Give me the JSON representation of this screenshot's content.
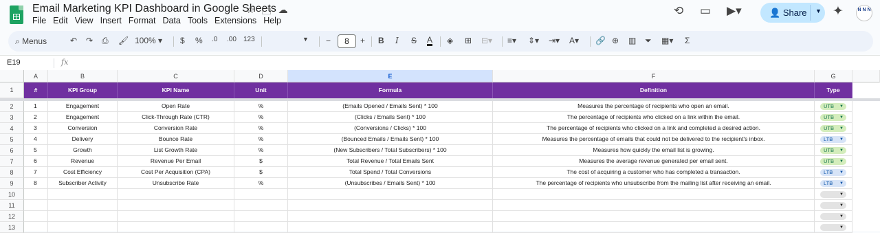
{
  "doc": {
    "title": "Email Marketing KPI Dashboard in Google Sheets"
  },
  "menu": [
    "File",
    "Edit",
    "View",
    "Insert",
    "Format",
    "Data",
    "Tools",
    "Extensions",
    "Help"
  ],
  "share": {
    "label": "Share"
  },
  "avatar": {
    "initials": "N N N"
  },
  "toolbar": {
    "menus_label": "Menus",
    "zoom": "100%",
    "currency": "$",
    "percent": "%",
    "dec_decrease": ".0",
    "dec_increase": ".00",
    "format_123": "123",
    "font_size": "8"
  },
  "formula_bar": {
    "cell_ref": "E19",
    "fx": "fx"
  },
  "columns": [
    "A",
    "B",
    "C",
    "D",
    "E",
    "F",
    "G"
  ],
  "headers": [
    "#",
    "KPI Group",
    "KPI Name",
    "Unit",
    "Formula",
    "Definition",
    "Type"
  ],
  "rows": [
    {
      "n": "1",
      "group": "Engagement",
      "name": "Open Rate",
      "unit": "%",
      "formula": "(Emails Opened / Emails Sent) * 100",
      "definition": "Measures the percentage of recipients who open an email.",
      "type": "UTB"
    },
    {
      "n": "2",
      "group": "Engagement",
      "name": "Click-Through Rate (CTR)",
      "unit": "%",
      "formula": "(Clicks / Emails Sent) * 100",
      "definition": "The percentage of recipients who clicked on a link within the email.",
      "type": "UTB"
    },
    {
      "n": "3",
      "group": "Conversion",
      "name": "Conversion Rate",
      "unit": "%",
      "formula": "(Conversions / Clicks) * 100",
      "definition": "The percentage of recipients who clicked on a link and completed a desired action.",
      "type": "UTB"
    },
    {
      "n": "4",
      "group": "Delivery",
      "name": "Bounce Rate",
      "unit": "%",
      "formula": "(Bounced Emails / Emails Sent) * 100",
      "definition": "Measures the percentage of emails that could not be delivered to the recipient's inbox.",
      "type": "LTB"
    },
    {
      "n": "5",
      "group": "Growth",
      "name": "List Growth Rate",
      "unit": "%",
      "formula": "(New Subscribers / Total Subscribers) * 100",
      "definition": "Measures how quickly the email list is growing.",
      "type": "UTB"
    },
    {
      "n": "6",
      "group": "Revenue",
      "name": "Revenue Per Email",
      "unit": "$",
      "formula": "Total Revenue / Total Emails Sent",
      "definition": "Measures the average revenue generated per email sent.",
      "type": "UTB"
    },
    {
      "n": "7",
      "group": "Cost Efficiency",
      "name": "Cost Per Acquisition (CPA)",
      "unit": "$",
      "formula": "Total Spend / Total Conversions",
      "definition": "The cost of acquiring a customer who has completed a transaction.",
      "type": "LTB"
    },
    {
      "n": "8",
      "group": "Subscriber Activity",
      "name": "Unsubscribe Rate",
      "unit": "%",
      "formula": "(Unsubscribes / Emails Sent) * 100",
      "definition": "The percentage of recipients who unsubscribe from the mailing list after receiving an email.",
      "type": "LTB"
    }
  ],
  "row_numbers": [
    "1",
    "2",
    "3",
    "4",
    "5",
    "6",
    "7",
    "8",
    "9",
    "10",
    "11",
    "12",
    "13"
  ],
  "colors": {
    "header_bg": "#7030a0",
    "utb_bg": "#d4edbc",
    "ltb_bg": "#d7e4f7",
    "accent": "#c2e7ff"
  }
}
